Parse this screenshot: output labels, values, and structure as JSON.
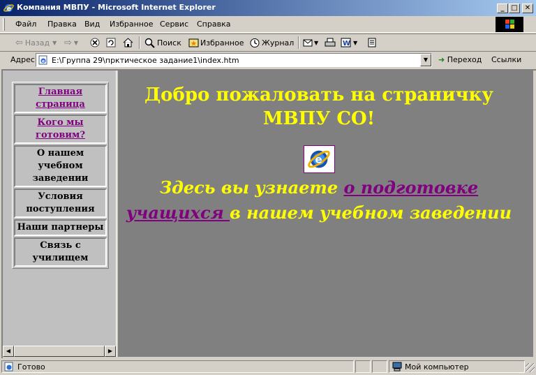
{
  "window": {
    "title": "Компания МВПУ - Microsoft Internet Explorer",
    "minimize": "_",
    "maximize": "□",
    "close": "✕"
  },
  "menu": [
    "Файл",
    "Правка",
    "Вид",
    "Избранное",
    "Сервис",
    "Справка"
  ],
  "toolbar": {
    "back": "Назад",
    "search": "Поиск",
    "favorites": "Избранное",
    "history": "Журнал"
  },
  "address": {
    "label": "Адрес",
    "value": "E:\\Группа 29\\прктическое задание1\\index.htm",
    "go": "Переход",
    "links": "Ссылки"
  },
  "nav": {
    "items": [
      {
        "label": "Главная страница",
        "link": true
      },
      {
        "label": "Кого мы готовим?",
        "link": true
      },
      {
        "label": "О нашем учебном заведении",
        "link": false
      },
      {
        "label": "Условия поступления",
        "link": false
      },
      {
        "label": "Наши партнеры",
        "link": false
      },
      {
        "label": "Связь с училищем",
        "link": false
      }
    ]
  },
  "main": {
    "welcome": "Добро пожаловать на страничку МВПУ СО!",
    "tagline_before": "Здесь вы узнаете ",
    "tagline_link": "о подготовке учащихся ",
    "tagline_after": "в нашем учебном заведении"
  },
  "status": {
    "text": "Готово",
    "zone": "Мой компьютер"
  },
  "colors": {
    "heading": "#ffff00",
    "link_visited": "#800080",
    "main_bg": "#808080",
    "nav_bg": "#c0c0c0"
  }
}
